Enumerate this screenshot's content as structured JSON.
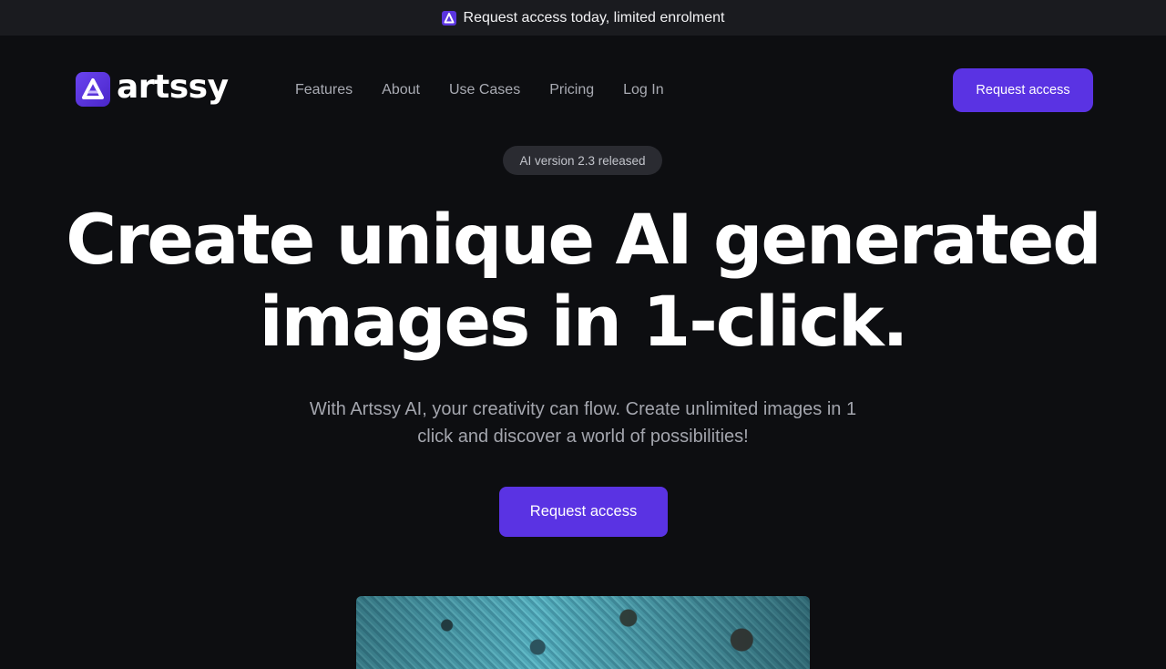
{
  "announcement": {
    "icon": "artssy-logo-icon",
    "text": "Request access today, limited enrolment"
  },
  "header": {
    "logo_text": "artssy",
    "nav": [
      {
        "label": "Features"
      },
      {
        "label": "About"
      },
      {
        "label": "Use Cases"
      },
      {
        "label": "Pricing"
      },
      {
        "label": "Log In"
      }
    ],
    "cta_label": "Request access"
  },
  "hero": {
    "badge": "AI version 2.3 released",
    "headline_line1": "Create unique AI generated",
    "headline_line2": "images in 1-click.",
    "subtext_line1": "With Artssy AI, your creativity can flow. Create unlimited images in 1",
    "subtext_line2": "click and discover a world of possibilities!",
    "cta_label": "Request access"
  },
  "colors": {
    "background": "#0d0e11",
    "announcement_bar": "#1a1b1f",
    "accent": "#5a33e3",
    "badge_bg": "#2a2b31",
    "muted_text": "#a3a5ad"
  }
}
